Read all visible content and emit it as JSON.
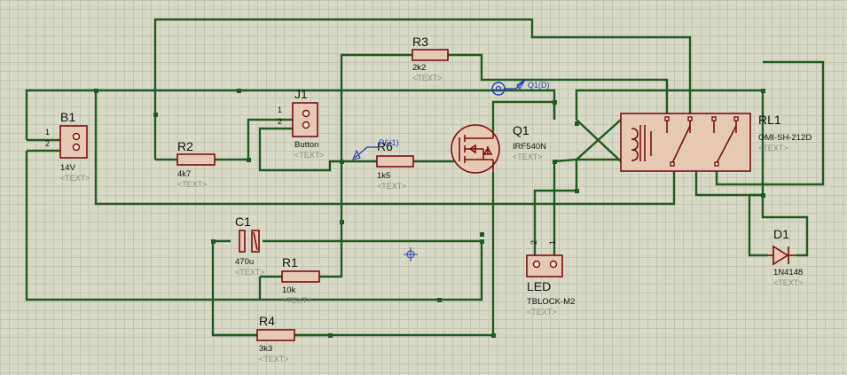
{
  "components": {
    "B1": {
      "ref": "B1",
      "value": "14V",
      "text": "<TEXT>",
      "pin1": "1",
      "pin2": "2"
    },
    "J1": {
      "ref": "J1",
      "value": "Button",
      "text": "<TEXT>",
      "pin1": "1",
      "pin2": "2"
    },
    "R2": {
      "ref": "R2",
      "value": "4k7",
      "text": "<TEXT>"
    },
    "R3": {
      "ref": "R3",
      "value": "2k2",
      "text": "<TEXT>"
    },
    "R6": {
      "ref": "R6",
      "value": "1k5",
      "text": "<TEXT>"
    },
    "Q1": {
      "ref": "Q1",
      "value": "IRF540N",
      "text": "<TEXT>"
    },
    "RL1": {
      "ref": "RL1",
      "value": "OMI-SH-212D",
      "text": "<TEXT>"
    },
    "C1": {
      "ref": "C1",
      "value": "470u",
      "text": "<TEXT>"
    },
    "R1": {
      "ref": "R1",
      "value": "10k",
      "text": "<TEXT>"
    },
    "R4": {
      "ref": "R4",
      "value": "3k3",
      "text": "<TEXT>"
    },
    "LED": {
      "ref": "LED",
      "value": "TBLOCK-M2",
      "text": "<TEXT>",
      "pin1": "1",
      "pin2": "2"
    },
    "D1": {
      "ref": "D1",
      "value": "1N4148",
      "text": "<TEXT>"
    }
  },
  "probes": {
    "q1d": "Q1(D)",
    "r6": "R6(1)"
  },
  "colors": {
    "background": "#d9d9c7",
    "wire": "#1f5a1f",
    "component": "#7a0e0e",
    "probe": "#1f3fb0"
  }
}
